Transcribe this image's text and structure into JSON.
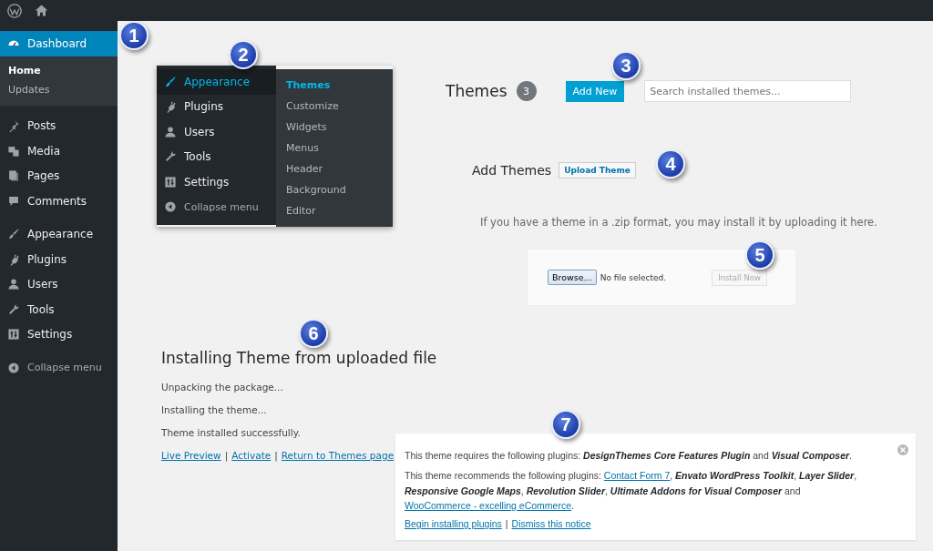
{
  "sidebar": {
    "groups": [
      [
        {
          "label": "Dashboard",
          "kind": "dashboard",
          "selected": true,
          "children": [
            {
              "label": "Home",
              "selected": true
            },
            {
              "label": "Updates",
              "selected": false
            }
          ]
        }
      ],
      [
        {
          "label": "Posts",
          "kind": "pin",
          "selected": false
        },
        {
          "label": "Media",
          "kind": "media",
          "selected": false
        },
        {
          "label": "Pages",
          "kind": "pages",
          "selected": false
        },
        {
          "label": "Comments",
          "kind": "comment",
          "selected": false
        }
      ],
      [
        {
          "label": "Appearance",
          "kind": "brush",
          "selected": false
        },
        {
          "label": "Plugins",
          "kind": "plug",
          "selected": false
        },
        {
          "label": "Users",
          "kind": "user",
          "selected": false
        },
        {
          "label": "Tools",
          "kind": "wrench",
          "selected": false
        },
        {
          "label": "Settings",
          "kind": "settings",
          "selected": false
        }
      ]
    ],
    "collapse": "Collapse menu"
  },
  "flyout": {
    "items": [
      {
        "label": "Appearance",
        "kind": "brush",
        "selected": true
      },
      {
        "label": "Plugins",
        "kind": "plug",
        "selected": false
      },
      {
        "label": "Users",
        "kind": "user",
        "selected": false
      },
      {
        "label": "Tools",
        "kind": "wrench",
        "selected": false
      },
      {
        "label": "Settings",
        "kind": "settings",
        "selected": false
      }
    ],
    "collapse": "Collapse menu",
    "submenu": [
      {
        "label": "Themes",
        "selected": true
      },
      {
        "label": "Customize",
        "selected": false
      },
      {
        "label": "Widgets",
        "selected": false
      },
      {
        "label": "Menus",
        "selected": false
      },
      {
        "label": "Header",
        "selected": false
      },
      {
        "label": "Background",
        "selected": false
      },
      {
        "label": "Editor",
        "selected": false
      }
    ]
  },
  "themes_header": {
    "title": "Themes",
    "count": "3",
    "add_button": "Add New",
    "search_placeholder": "Search installed themes..."
  },
  "add_themes": {
    "title": "Add Themes",
    "button": "Upload Theme"
  },
  "upload": {
    "hint": "If you have a theme in a .zip format, you may install it by uploading it here.",
    "browse": "Browse...",
    "file_status": "No file selected.",
    "install": "Install Now",
    "install_disabled": true
  },
  "installing": {
    "title": "Installing Theme from uploaded file",
    "steps": [
      "Unpacking the package...",
      "Installing the theme...",
      "Theme installed successfully."
    ],
    "links": [
      {
        "kind": "link",
        "text": "Live Preview"
      },
      {
        "kind": "sep",
        "text": "|"
      },
      {
        "kind": "link",
        "text": "Activate"
      },
      {
        "kind": "sep",
        "text": "|"
      },
      {
        "kind": "link",
        "text": "Return to Themes page"
      }
    ]
  },
  "notice": {
    "lines": [
      [
        {
          "kind": "plain",
          "text": "This theme requires the following plugins: "
        },
        {
          "kind": "strong",
          "text": "DesignThemes Core Features Plugin"
        },
        {
          "kind": "plain",
          "text": " and "
        },
        {
          "kind": "strong",
          "text": "Visual Composer"
        },
        {
          "kind": "plain",
          "text": "."
        }
      ],
      [
        {
          "kind": "plain",
          "text": "This theme recommends the following plugins: "
        },
        {
          "kind": "link",
          "text": "Contact Form 7"
        },
        {
          "kind": "plain",
          "text": ", "
        },
        {
          "kind": "strong",
          "text": "Envato WordPress Toolkit"
        },
        {
          "kind": "plain",
          "text": ", "
        },
        {
          "kind": "strong",
          "text": "Layer Slider"
        },
        {
          "kind": "plain",
          "text": ", "
        },
        {
          "kind": "strong",
          "text": "Responsive Google Maps"
        },
        {
          "kind": "plain",
          "text": ", "
        },
        {
          "kind": "strong",
          "text": "Revolution Slider"
        },
        {
          "kind": "plain",
          "text": ", "
        },
        {
          "kind": "strong",
          "text": "Ultimate Addons for Visual Composer"
        },
        {
          "kind": "plain",
          "text": " and "
        },
        {
          "kind": "link",
          "text": "WooCommerce - excelling eCommerce"
        },
        {
          "kind": "plain",
          "text": "."
        }
      ]
    ],
    "actions": [
      {
        "kind": "link",
        "text": "Begin installing plugins"
      },
      {
        "kind": "sep",
        "text": "|"
      },
      {
        "kind": "link",
        "text": "Dismiss this notice"
      }
    ]
  },
  "callouts": [
    "1",
    "2",
    "3",
    "4",
    "5",
    "6",
    "7"
  ]
}
